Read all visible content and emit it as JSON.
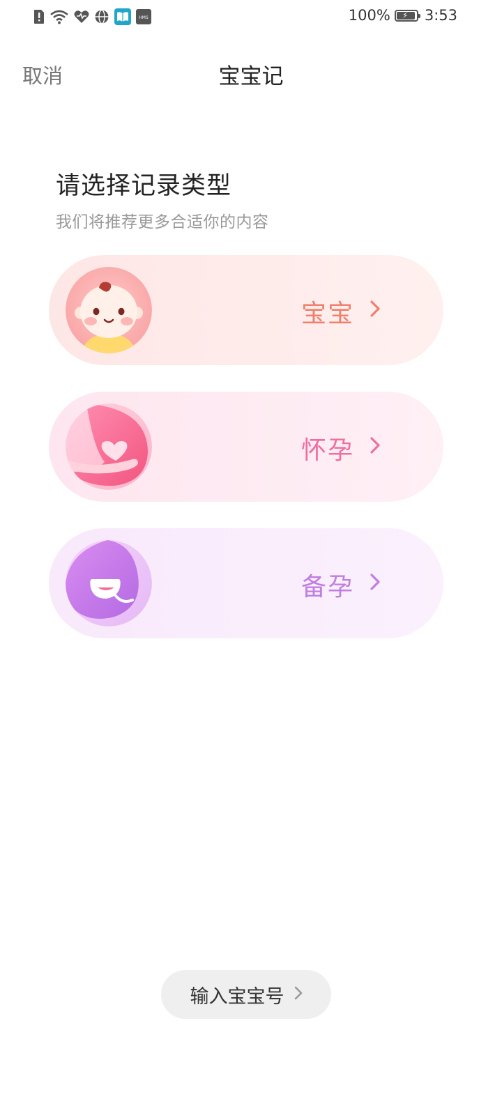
{
  "status_bar": {
    "icons": [
      "sim-alert-icon",
      "wifi-icon",
      "health-icon",
      "vpn-globe-icon",
      "reader-app-icon",
      "hms-icon"
    ],
    "hms_text": "HMS",
    "battery_percent": "100%",
    "battery_level": 1.0,
    "battery_icon": "battery-charging-icon",
    "time": "3:53"
  },
  "header": {
    "cancel_label": "取消",
    "title": "宝宝记"
  },
  "prompt": {
    "heading": "请选择记录类型",
    "subtitle": "我们将推荐更多合适你的内容"
  },
  "options": [
    {
      "label": "宝宝",
      "icon": "baby-face-icon",
      "color": "#ef806d",
      "chevron_icon": "chevron-right-icon"
    },
    {
      "label": "怀孕",
      "icon": "pregnant-belly-icon",
      "color": "#ef6fa0",
      "chevron_icon": "chevron-right-icon"
    },
    {
      "label": "备孕",
      "icon": "smile-bubble-icon",
      "color": "#c17ee0",
      "chevron_icon": "chevron-right-icon"
    }
  ],
  "footer": {
    "baby_id_label": "输入宝宝号",
    "chevron_icon": "chevron-right-icon"
  }
}
